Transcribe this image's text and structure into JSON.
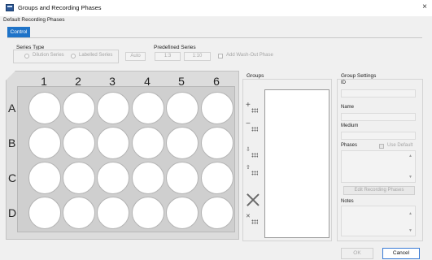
{
  "window": {
    "title": "Groups and Recording Phases",
    "close_glyph": "×"
  },
  "default_phases_label": "Default Recording Phases",
  "tabs": [
    {
      "label": "Control",
      "selected": true
    }
  ],
  "series_type": {
    "label": "Series Type",
    "options": [
      {
        "label": "Dilution Series"
      },
      {
        "label": "Labelled Series"
      }
    ]
  },
  "auto_button": "Auto",
  "predefined_series": {
    "label": "Predefined Series",
    "buttons": [
      "1:3",
      "1:10"
    ]
  },
  "washout": {
    "label": "Add Wash-Out Phase",
    "checked": false
  },
  "plate": {
    "columns": [
      "1",
      "2",
      "3",
      "4",
      "5",
      "6"
    ],
    "rows": [
      "A",
      "B",
      "C",
      "D"
    ]
  },
  "groups": {
    "label": "Groups",
    "tools": [
      {
        "name": "add-group-icon",
        "glyph": "+"
      },
      {
        "name": "remove-group-icon",
        "glyph": "−"
      },
      {
        "name": "move-down-icon",
        "glyph": "⇩"
      },
      {
        "name": "move-up-icon",
        "glyph": "⇧"
      },
      {
        "name": "clear-all-icon",
        "glyph": ""
      },
      {
        "name": "clear-wells-icon",
        "glyph": "✕"
      }
    ]
  },
  "group_settings": {
    "label": "Group Settings",
    "id_label": "ID",
    "name_label": "Name",
    "medium_label": "Medium",
    "phases_label": "Phases",
    "use_default_label": "Use Default",
    "edit_phases_button": "Edit Recording Phases",
    "notes_label": "Notes"
  },
  "footer": {
    "ok_label": "OK",
    "cancel_label": "Cancel"
  },
  "colors": {
    "accent": "#1e73c8",
    "well": "#ffffff",
    "plate": "#d3d3d3"
  }
}
